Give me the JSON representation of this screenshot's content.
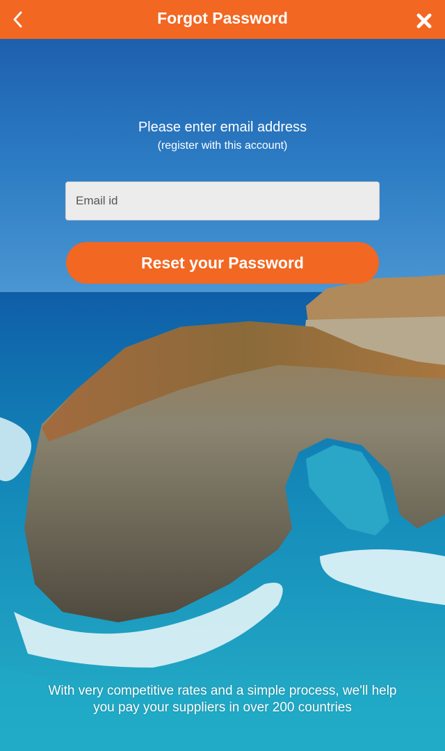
{
  "header": {
    "title": "Forgot Password",
    "back_icon": "chevron-left-icon",
    "close_icon": "close-icon"
  },
  "form": {
    "prompt": "Please enter email address",
    "prompt_sub": "(register with this account)",
    "email_placeholder": "Email id",
    "email_value": "",
    "submit_label": "Reset your Password"
  },
  "footer": {
    "line1": "With very competitive rates and a simple process,  we'll help",
    "line2": "you pay your suppliers in over 200 countries"
  },
  "colors": {
    "accent": "#f26722",
    "sky": "#1d6ab0",
    "sea": "#1a9fc4"
  }
}
